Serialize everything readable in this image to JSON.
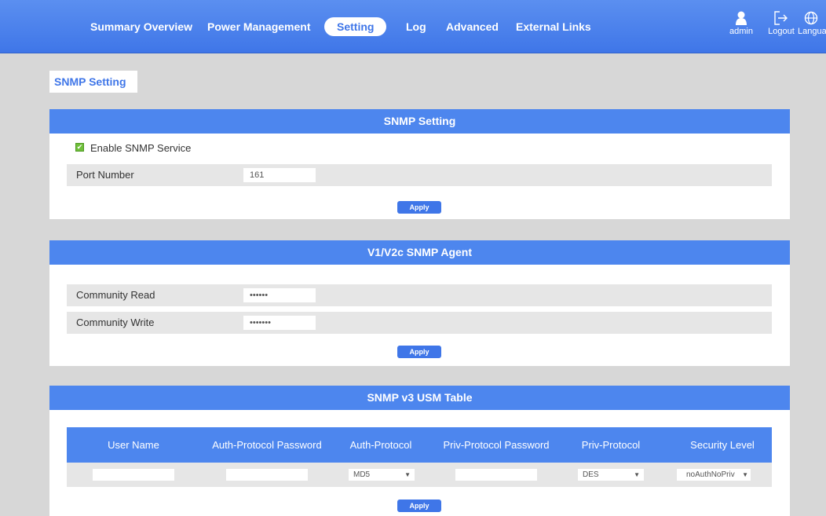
{
  "nav": {
    "items": [
      {
        "label": "Summary Overview"
      },
      {
        "label": "Power Management"
      },
      {
        "label": "Setting",
        "active": true
      },
      {
        "label": "Log"
      },
      {
        "label": "Advanced"
      },
      {
        "label": "External Links"
      }
    ],
    "user_label": "admin",
    "logout_label": "Logout",
    "language_label": "Language"
  },
  "page_tab": "SNMP Setting",
  "snmp_setting": {
    "title": "SNMP Setting",
    "enable_label": "Enable SNMP Service",
    "enable_checked": true,
    "port_label": "Port Number",
    "port_value": "161",
    "apply_label": "Apply"
  },
  "v1v2c": {
    "title": "V1/V2c SNMP Agent",
    "community_read_label": "Community Read",
    "community_read_value": "••••••",
    "community_write_label": "Community Write",
    "community_write_value": "•••••••",
    "apply_label": "Apply"
  },
  "usm": {
    "title": "SNMP v3 USM Table",
    "columns": [
      "User Name",
      "Auth-Protocol Password",
      "Auth-Protocol",
      "Priv-Protocol Password",
      "Priv-Protocol",
      "Security Level"
    ],
    "auth_protocol": "MD5",
    "priv_protocol": "DES",
    "security_level": "noAuthNoPriv",
    "apply_label": "Apply"
  },
  "colors": {
    "accent": "#3f76e8",
    "header": "#4d86ee",
    "background": "#d7d7d7",
    "check": "#6fbf3a"
  }
}
